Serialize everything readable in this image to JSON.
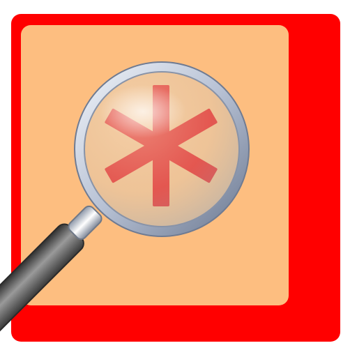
{
  "icon": {
    "name": "search-special-characters-icon",
    "elements": [
      "red-frame",
      "peach-panel",
      "magnifier-lens",
      "asterisk-symbol",
      "magnifier-handle"
    ]
  },
  "colors": {
    "frame": "#ff0000",
    "panel": "#fdbe80",
    "asterisk": "#e21f2c",
    "lens_ring": "#c9d2e4",
    "lens_ring_dark": "#7a869c",
    "handle_dark": "#3f3f3f",
    "handle_light": "#a9a9a9",
    "background": "#ffffff"
  }
}
